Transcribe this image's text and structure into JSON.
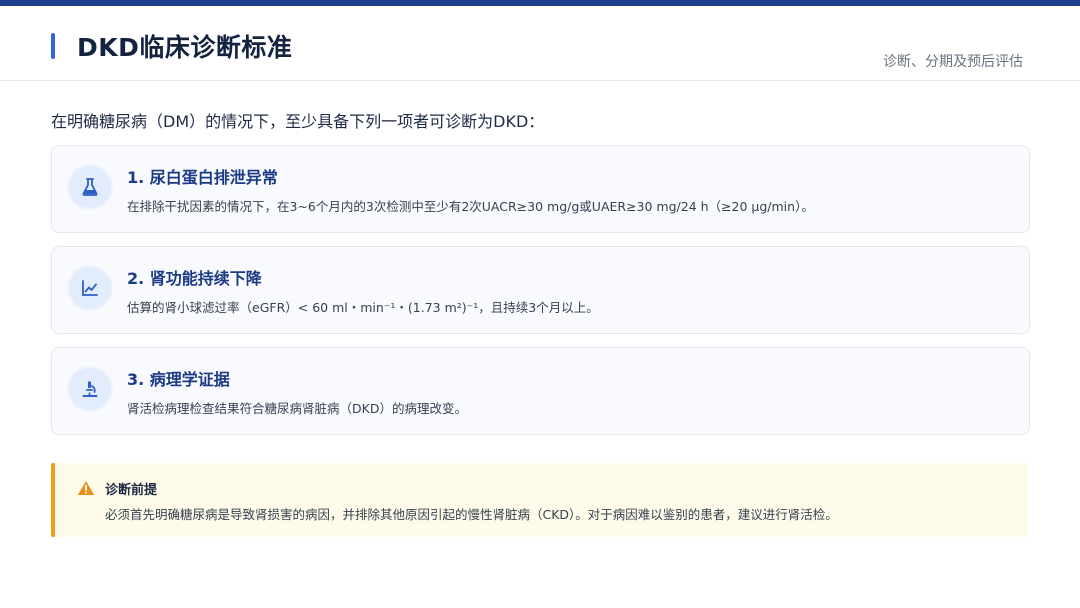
{
  "header": {
    "title": "DKD临床诊断标准",
    "subtitle": "诊断、分期及预后评估"
  },
  "intro": "在明确糖尿病（DM）的情况下，至少具备下列一项者可诊断为DKD：",
  "criteria": [
    {
      "icon": "flask-icon",
      "title": "1. 尿白蛋白排泄异常",
      "description": "在排除干扰因素的情况下，在3~6个月内的3次检测中至少有2次UACR≥30 mg/g或UAER≥30 mg/24 h（≥20 μg/min）。"
    },
    {
      "icon": "line-chart-icon",
      "title": "2. 肾功能持续下降",
      "description": "估算的肾小球滤过率（eGFR）< 60 ml・min⁻¹・(1.73 m²)⁻¹，且持续3个月以上。"
    },
    {
      "icon": "microscope-icon",
      "title": "3. 病理学证据",
      "description": "肾活检病理检查结果符合糖尿病肾脏病（DKD）的病理改变。"
    }
  ],
  "note": {
    "icon": "warning-icon",
    "title": "诊断前提",
    "text": "必须首先明确糖尿病是导致肾损害的病因，并排除其他原因引起的慢性肾脏病（CKD）。对于病因难以鉴别的患者，建议进行肾活检。"
  },
  "colors": {
    "accent": "#2f6bd8",
    "top_bar": "#1f3f8f",
    "card_title": "#1b3b86",
    "warning": "#f0a020"
  }
}
